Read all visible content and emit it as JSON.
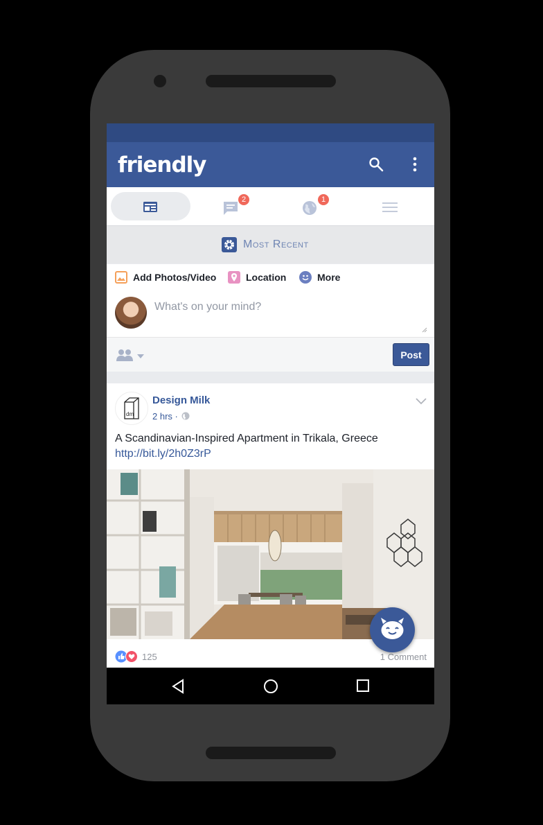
{
  "app": {
    "title": "friendly"
  },
  "tabs": [
    {
      "name": "news-feed",
      "badge": ""
    },
    {
      "name": "messages",
      "badge": "2"
    },
    {
      "name": "notifications",
      "badge": "1"
    },
    {
      "name": "menu",
      "badge": ""
    }
  ],
  "feed_filter": {
    "label": "Most Recent"
  },
  "composer": {
    "add_photos": "Add Photos/Video",
    "location": "Location",
    "more": "More",
    "placeholder": "What's on your mind?",
    "post": "Post"
  },
  "post": {
    "author": "Design Milk",
    "time": "2 hrs ·",
    "logo_text": "dm",
    "text": "A Scandinavian-Inspired Apartment in Trikala, Greece",
    "link": "http://bit.ly/2h0Z3rP",
    "reactions": "125",
    "comments": "1 Comment"
  },
  "colors": {
    "brand": "#3b5998",
    "status": "#2f4a82",
    "badge": "#f0685a"
  }
}
